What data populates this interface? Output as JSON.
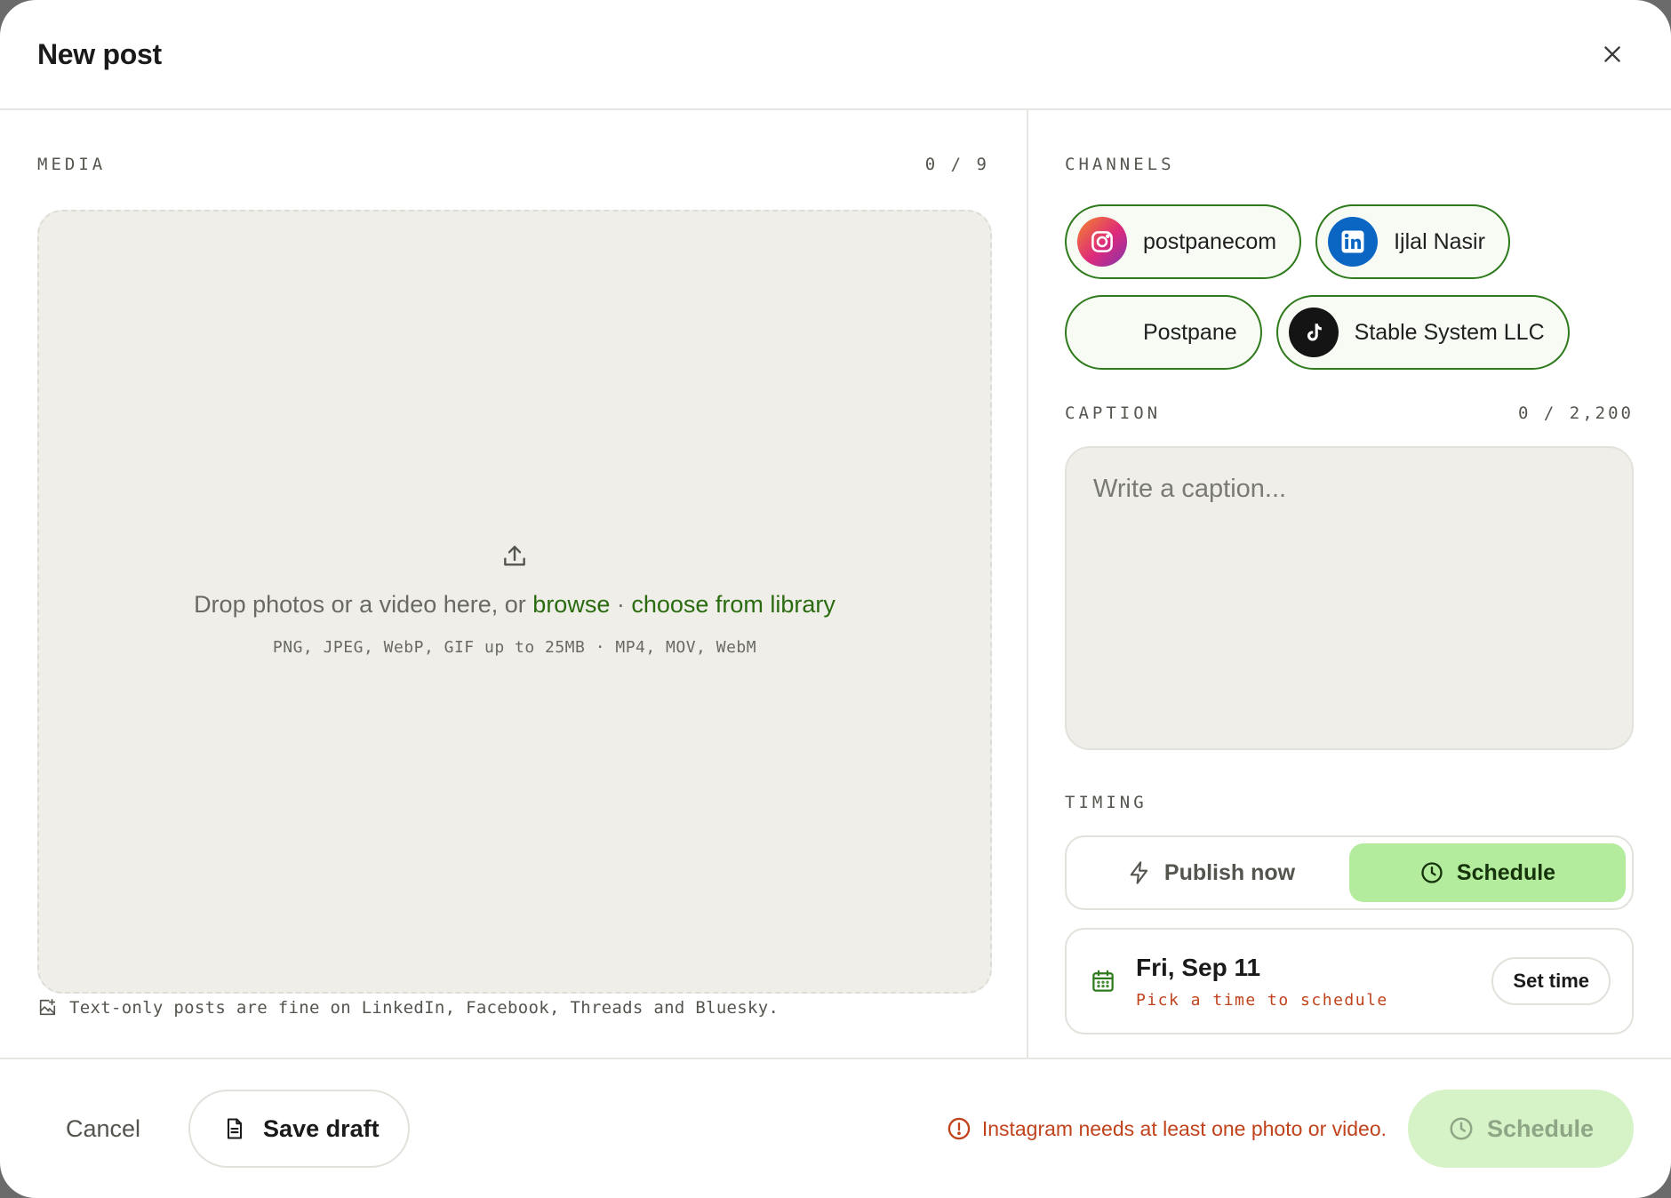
{
  "header": {
    "title": "New post"
  },
  "media": {
    "label": "MEDIA",
    "counter": "0 / 9",
    "drop_text": "Drop photos or a video here, or",
    "browse_link": "browse",
    "separator": " · ",
    "library_link": "choose from library",
    "formats": "PNG, JPEG, WebP, GIF up to 25MB · MP4, MOV, WebM",
    "note": "Text-only posts are fine on LinkedIn, Facebook, Threads and Bluesky."
  },
  "channels": {
    "label": "CHANNELS",
    "items": [
      {
        "name": "postpanecom",
        "icon": "instagram-icon"
      },
      {
        "name": "Ijlal Nasir",
        "icon": "linkedin-icon"
      },
      {
        "name": "Postpane",
        "icon": ""
      },
      {
        "name": "Stable System LLC",
        "icon": "tiktok-icon"
      }
    ]
  },
  "caption": {
    "label": "CAPTION",
    "counter": "0 / 2,200",
    "placeholder": "Write a caption..."
  },
  "timing": {
    "label": "TIMING",
    "publish_now": "Publish now",
    "schedule": "Schedule",
    "selected": "Schedule",
    "date": "Fri, Sep 11",
    "date_hint": "Pick a time to schedule",
    "set_time": "Set time"
  },
  "footer": {
    "cancel": "Cancel",
    "save_draft": "Save draft",
    "warning": "Instagram needs at least one photo or video.",
    "schedule": "Schedule"
  },
  "colors": {
    "accent_green": "#2a6b10",
    "active_green": "#b3ec9c",
    "warning_orange": "#c0431c"
  }
}
